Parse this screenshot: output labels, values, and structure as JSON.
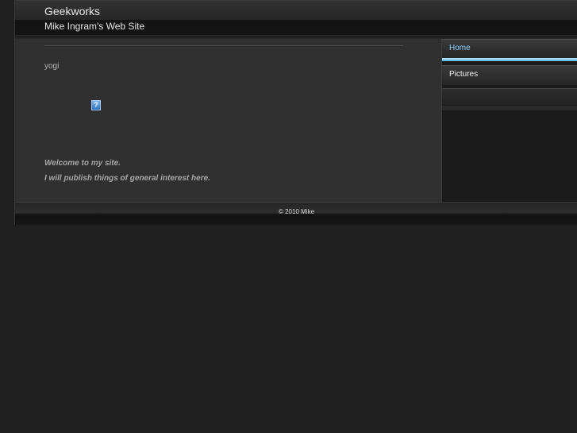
{
  "header": {
    "title": "Geekworks",
    "subtitle": "Mike Ingram's Web Site"
  },
  "post": {
    "title": "yogi",
    "image_icon": "broken-image-icon",
    "image_glyph": "?",
    "lines": [
      "Welcome to my site.",
      "I will publish things of general interest here."
    ]
  },
  "nav": {
    "items": [
      {
        "label": "Home",
        "active": true
      },
      {
        "label": "Pictures",
        "active": false
      }
    ]
  },
  "footer": {
    "copyright": "© 2010 Mike"
  },
  "colors": {
    "background": "#202020",
    "accent": "#8fd3ff",
    "active_bar": "#4fb0e6"
  }
}
